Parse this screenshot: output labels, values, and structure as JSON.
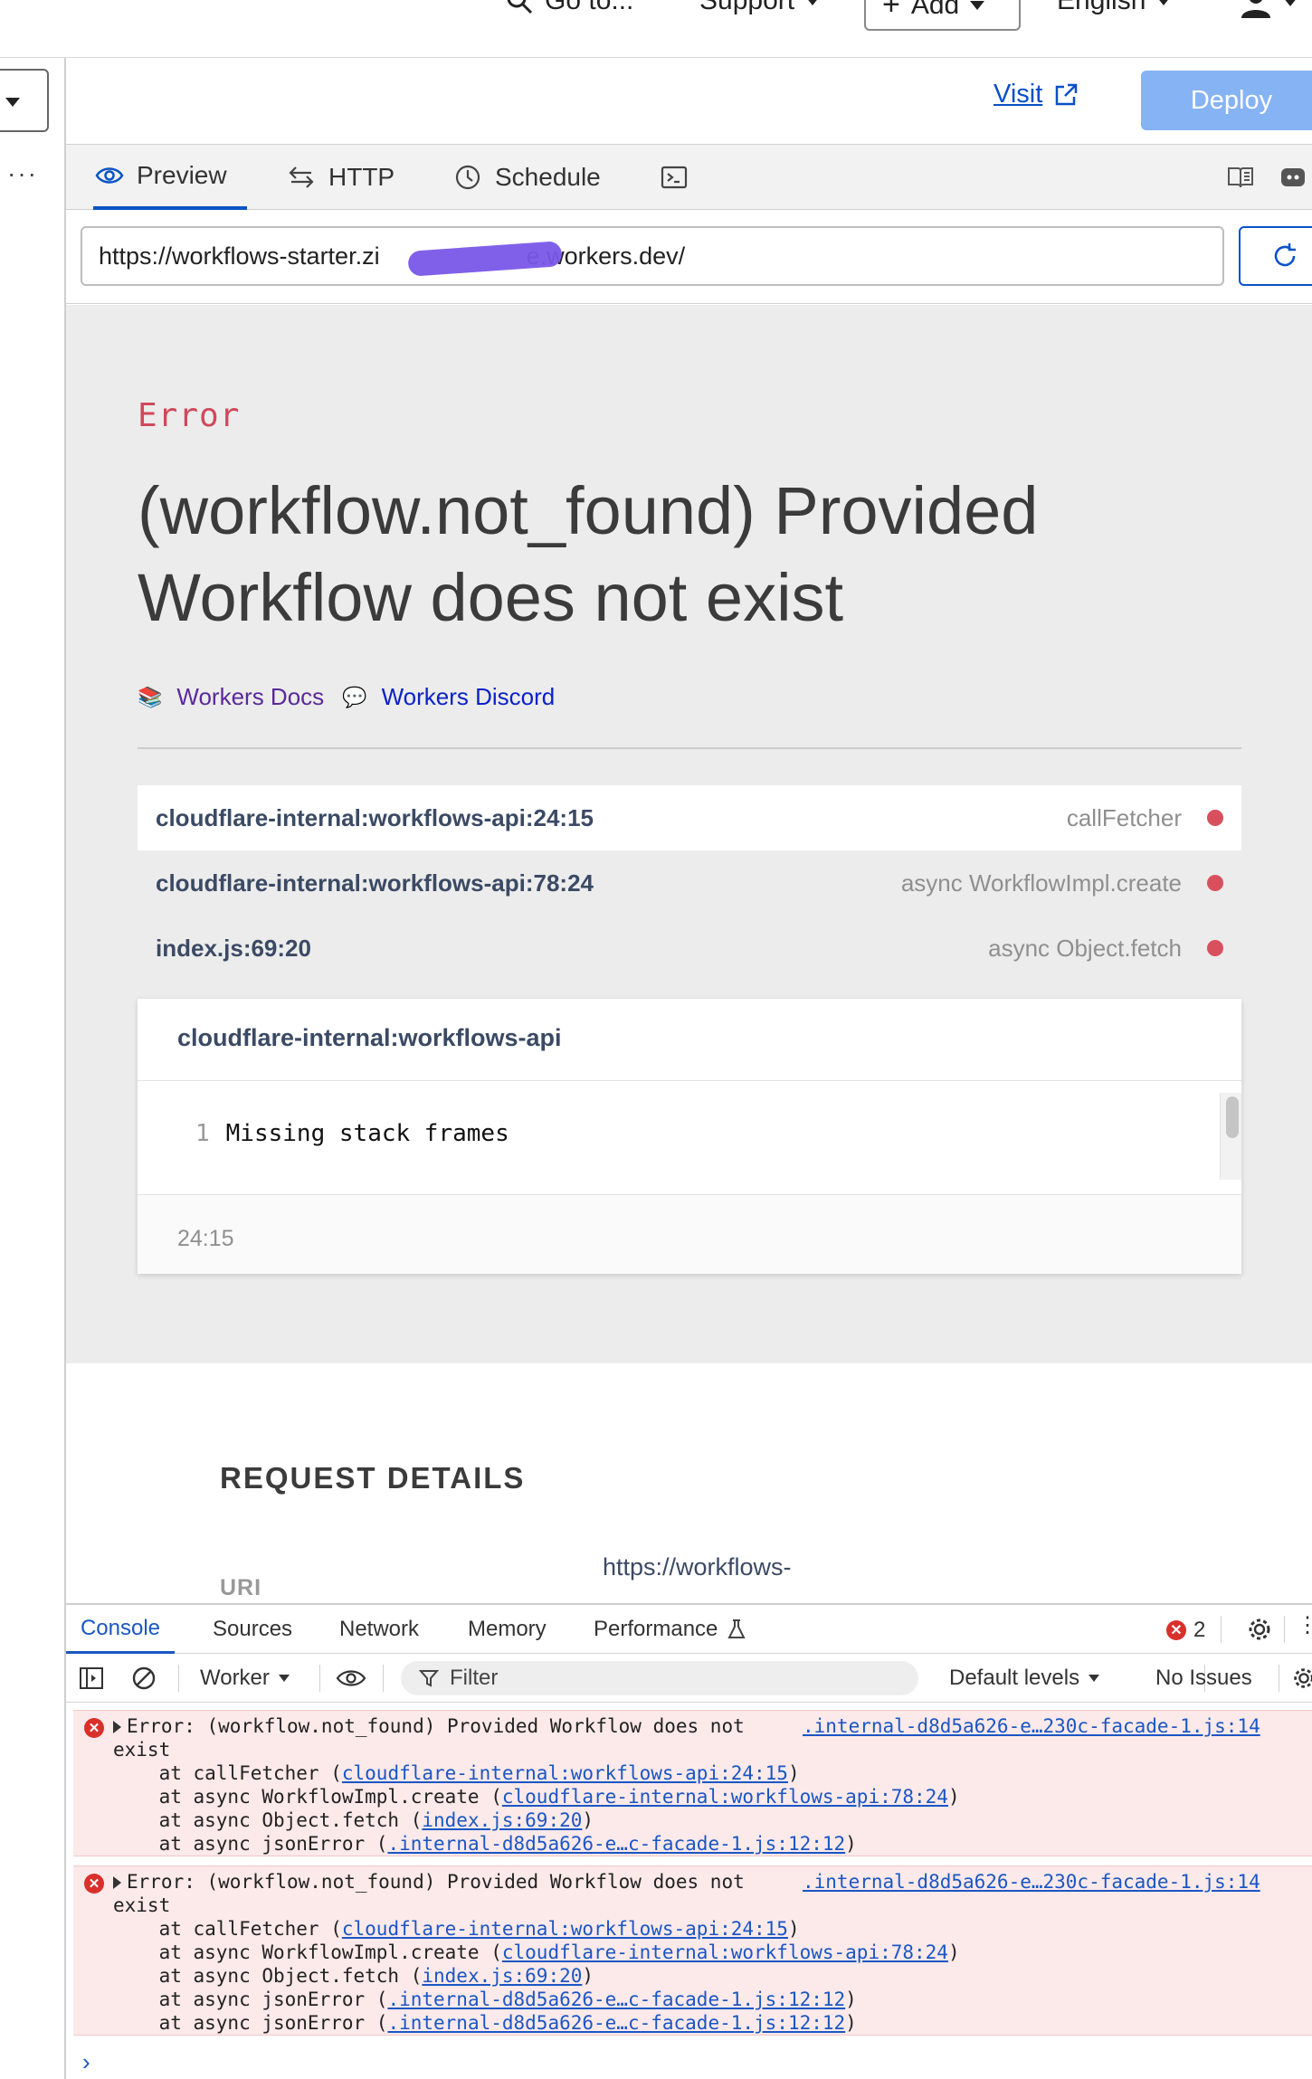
{
  "topbar": {
    "goto_label": "Go to...",
    "support_label": "Support",
    "add_label": "Add",
    "language_label": "English"
  },
  "header": {
    "visit_label": "Visit",
    "deploy_label": "Deploy"
  },
  "tabs": {
    "preview": "Preview",
    "http": "HTTP",
    "schedule": "Schedule"
  },
  "url_bar": {
    "value": "https://workflows-starter.zi      e.workers.dev/"
  },
  "error_page": {
    "label": "Error",
    "title": "(workflow.not_found) Provided Workflow does not exist",
    "docs_link": "Workers Docs",
    "discord_link": "Workers Discord",
    "frames": [
      {
        "location": "cloudflare-internal:workflows-api:24:15",
        "function": "callFetcher"
      },
      {
        "location": "cloudflare-internal:workflows-api:78:24",
        "function": "async WorkflowImpl.create"
      },
      {
        "location": "index.js:69:20",
        "function": "async Object.fetch"
      }
    ],
    "code_card": {
      "title": "cloudflare-internal:workflows-api",
      "line_number": "1",
      "line_text": "Missing stack frames",
      "position": "24:15"
    }
  },
  "request_details": {
    "heading": "REQUEST DETAILS",
    "uri_label": "URI",
    "uri_value": "https://workflows-"
  },
  "devtools": {
    "tabs": {
      "console": "Console",
      "sources": "Sources",
      "network": "Network",
      "memory": "Memory",
      "performance": "Performance"
    },
    "error_count": "2",
    "toolbar": {
      "context": "Worker",
      "filter_placeholder": "Filter",
      "levels": "Default levels",
      "issues": "No Issues"
    },
    "messages": [
      {
        "head": "Error: (workflow.not_found) Provided Workflow does not",
        "source": ".internal-d8d5a626-e…230c-facade-1.js:14",
        "cont": "exist",
        "frames": [
          {
            "prefix": "    at callFetcher (",
            "link": "cloudflare-internal:workflows-api:24:15",
            "suffix": ")"
          },
          {
            "prefix": "    at async WorkflowImpl.create (",
            "link": "cloudflare-internal:workflows-api:78:24",
            "suffix": ")"
          },
          {
            "prefix": "    at async Object.fetch (",
            "link": "index.js:69:20",
            "suffix": ")"
          },
          {
            "prefix": "    at async jsonError (",
            "link": ".internal-d8d5a626-e…c-facade-1.js:12:12",
            "suffix": ")"
          }
        ]
      },
      {
        "head": "Error: (workflow.not_found) Provided Workflow does not",
        "source": ".internal-d8d5a626-e…230c-facade-1.js:14",
        "cont": "exist",
        "frames": [
          {
            "prefix": "    at callFetcher (",
            "link": "cloudflare-internal:workflows-api:24:15",
            "suffix": ")"
          },
          {
            "prefix": "    at async WorkflowImpl.create (",
            "link": "cloudflare-internal:workflows-api:78:24",
            "suffix": ")"
          },
          {
            "prefix": "    at async Object.fetch (",
            "link": "index.js:69:20",
            "suffix": ")"
          },
          {
            "prefix": "    at async jsonError (",
            "link": ".internal-d8d5a626-e…c-facade-1.js:12:12",
            "suffix": ")"
          },
          {
            "prefix": "    at async jsonError (",
            "link": ".internal-d8d5a626-e…c-facade-1.js:12:12",
            "suffix": ")"
          }
        ]
      }
    ],
    "prompt_symbol": "›"
  }
}
